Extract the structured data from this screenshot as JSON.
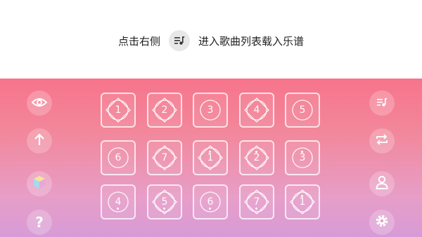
{
  "hint": {
    "before": "点击右侧",
    "after": "进入歌曲列表载入乐谱"
  },
  "pads": [
    {
      "label": "1",
      "dot": "none",
      "shape": "diamond"
    },
    {
      "label": "2",
      "dot": "none",
      "shape": "diamond"
    },
    {
      "label": "3",
      "dot": "none",
      "shape": "circle"
    },
    {
      "label": "4",
      "dot": "none",
      "shape": "diamond"
    },
    {
      "label": "5",
      "dot": "none",
      "shape": "circle"
    },
    {
      "label": "6",
      "dot": "none",
      "shape": "circle"
    },
    {
      "label": "7",
      "dot": "none",
      "shape": "diamond"
    },
    {
      "label": "1",
      "dot": "top",
      "shape": "diamond"
    },
    {
      "label": "2",
      "dot": "top",
      "shape": "diamond"
    },
    {
      "label": "3",
      "dot": "top",
      "shape": "circle"
    },
    {
      "label": "4",
      "dot": "bottom",
      "shape": "circle"
    },
    {
      "label": "5",
      "dot": "bottom",
      "shape": "diamond"
    },
    {
      "label": "6",
      "dot": "bottom",
      "shape": "circle"
    },
    {
      "label": "7",
      "dot": "bottom",
      "shape": "diamond"
    },
    {
      "label": "1",
      "dot": "top",
      "shape": "diamond"
    }
  ],
  "icons": {
    "hint": "playlist-icon",
    "left": [
      "eye-icon",
      "arrow-up-icon",
      "cube-icon",
      "help-icon"
    ],
    "right": [
      "playlist-icon",
      "repeat-icon",
      "user-icon",
      "settings-icon"
    ]
  },
  "colors": {
    "accent_top": "#f7748b",
    "accent_bottom": "#d79bd7"
  }
}
